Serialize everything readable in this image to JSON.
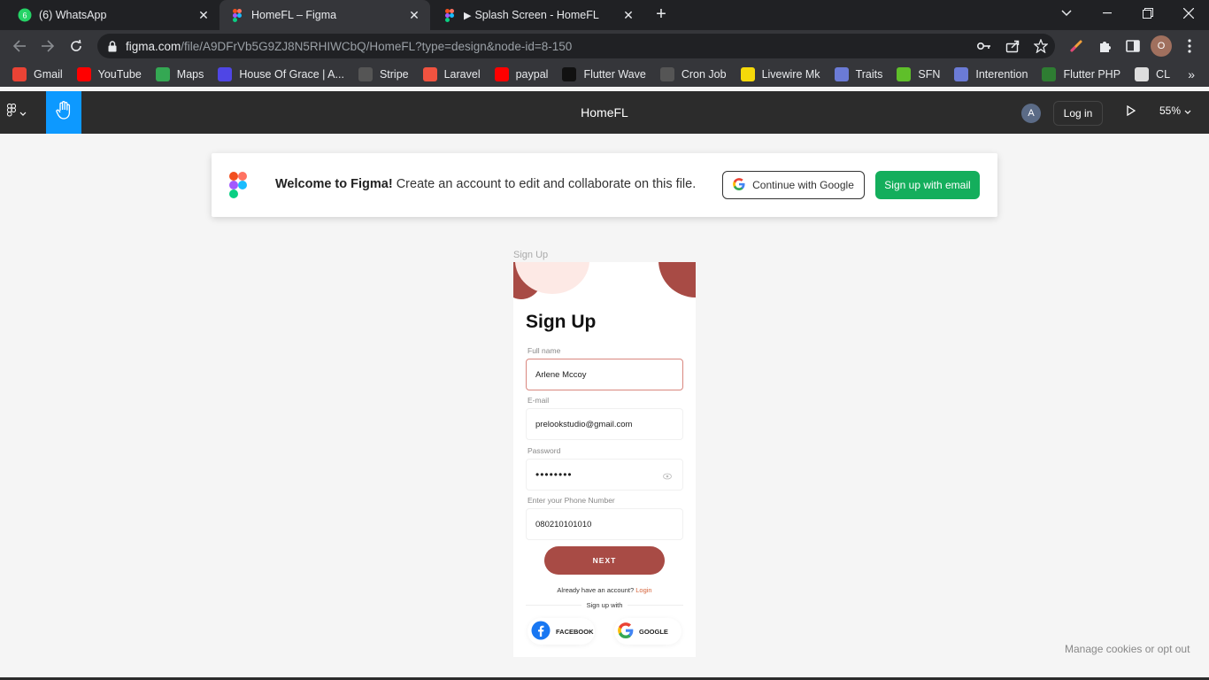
{
  "browser": {
    "tabs": [
      {
        "title": "(6) WhatsApp",
        "badge": "6",
        "icon": "whatsapp-icon"
      },
      {
        "title": "HomeFL – Figma",
        "icon": "figma-icon"
      },
      {
        "title": "Splash Screen - HomeFL",
        "icon": "figma-icon"
      }
    ],
    "url_host": "figma.com",
    "url_path": "/file/A9DFrVb5G9ZJ8N5RHIWCbQ/HomeFL?type=design&node-id=8-150",
    "profile_initial": "O",
    "bookmarks": [
      {
        "label": "Gmail",
        "icon": "gmail-icon",
        "color": "#ea4335"
      },
      {
        "label": "YouTube",
        "icon": "youtube-icon",
        "color": "#ff0000"
      },
      {
        "label": "Maps",
        "icon": "maps-icon",
        "color": "#34a853"
      },
      {
        "label": "House Of Grace | A...",
        "icon": "laravel-icon",
        "color": "#4f46e5"
      },
      {
        "label": "Stripe",
        "icon": "stripe-icon",
        "color": "#555555"
      },
      {
        "label": "Laravel",
        "icon": "laravel-icon",
        "color": "#f05340"
      },
      {
        "label": "paypal",
        "icon": "youtube-icon",
        "color": "#ff0000"
      },
      {
        "label": "Flutter Wave",
        "icon": "medium-icon",
        "color": "#111111"
      },
      {
        "label": "Cron Job",
        "icon": "cron-icon",
        "color": "#555555"
      },
      {
        "label": "Livewire Mk",
        "icon": "livewire-icon",
        "color": "#f5d90a"
      },
      {
        "label": "Traits",
        "icon": "php-icon",
        "color": "#6b7bd6"
      },
      {
        "label": "SFN",
        "icon": "download-icon",
        "color": "#5fbf2a"
      },
      {
        "label": "Interention",
        "icon": "php-icon",
        "color": "#6b7bd6"
      },
      {
        "label": "Flutter PHP",
        "icon": "codeigniter-icon",
        "color": "#2e7d32"
      },
      {
        "label": "CL",
        "icon": "github-icon",
        "color": "#dddddd"
      }
    ]
  },
  "figma": {
    "file_title": "HomeFL",
    "avatar_initial": "A",
    "login_label": "Log in",
    "zoom": "55%"
  },
  "banner": {
    "bold": "Welcome to Figma!",
    "text": " Create an account to edit and collaborate on this file.",
    "google_label": "Continue with Google",
    "email_label": "Sign up with email"
  },
  "frame": {
    "label": "Sign Up",
    "title": "Sign Up",
    "fields": [
      {
        "label": "Full name",
        "value": "Arlene Mccoy"
      },
      {
        "label": "E-mail",
        "value": "prelookstudio@gmail.com"
      },
      {
        "label": "Password",
        "value": "••••••••"
      },
      {
        "label": "Enter your Phone Number",
        "value": "080210101010"
      }
    ],
    "next_label": "NEXT",
    "already_text": "Already have an account?",
    "login_link": "Login",
    "sign_up_with": "Sign up with",
    "facebook_label": "FACEBOOK",
    "google_label": "GOOGLE"
  },
  "footer": {
    "cookies": "Manage cookies or opt out"
  },
  "colors": {
    "figma_blue": "#0d99ff",
    "green": "#14ae5c",
    "brick": "#a84b45",
    "blush": "#fde9e5"
  }
}
